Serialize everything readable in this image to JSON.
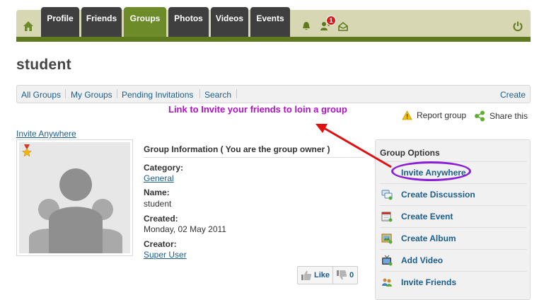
{
  "nav": {
    "tabs": [
      {
        "label": "Profile"
      },
      {
        "label": "Friends"
      },
      {
        "label": "Groups"
      },
      {
        "label": "Photos"
      },
      {
        "label": "Videos"
      },
      {
        "label": "Events"
      }
    ],
    "notification_count": "1",
    "active_color": "#6e8b2a",
    "tab_color": "#3f3f3f"
  },
  "page": {
    "title": "student"
  },
  "subnav": {
    "items": [
      {
        "label": "All Groups"
      },
      {
        "label": "My Groups"
      },
      {
        "label": "Pending Invitations"
      },
      {
        "label": "Search"
      }
    ],
    "create_label": "Create"
  },
  "annotation": {
    "text": "Link to Invite your friends to loin a group",
    "color": "#b010c8"
  },
  "actions": {
    "report": "Report group",
    "share": "Share this"
  },
  "invite_top": "Invite Anywhere",
  "group_info": {
    "heading": "Group Information ( You are the group owner )",
    "category_label": "Category:",
    "category_value": "General",
    "name_label": "Name:",
    "name_value": "student",
    "created_label": "Created:",
    "created_value": "Monday, 02 May 2011",
    "creator_label": "Creator:",
    "creator_value": "Super User"
  },
  "likes": {
    "like_label": "Like",
    "dislike_count": "0"
  },
  "options": {
    "title": "Group Options",
    "items": [
      {
        "label": "Invite Anywhere",
        "icon": "invite-icon"
      },
      {
        "label": "Create Discussion",
        "icon": "discussion-icon"
      },
      {
        "label": "Create Event",
        "icon": "calendar-icon"
      },
      {
        "label": "Create Album",
        "icon": "album-icon"
      },
      {
        "label": "Add Video",
        "icon": "tv-icon"
      },
      {
        "label": "Invite Friends",
        "icon": "users-icon"
      }
    ]
  }
}
